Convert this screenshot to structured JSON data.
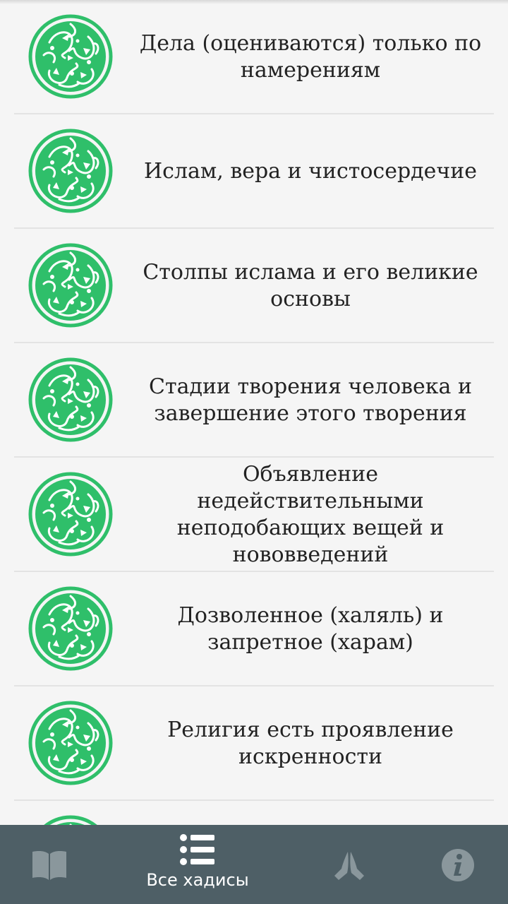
{
  "colors": {
    "accent": "#2fbf6a",
    "nav_background": "#4e5f66",
    "nav_inactive": "#8a979c",
    "nav_active": "#ffffff"
  },
  "hadiths": [
    {
      "title": "Дела (оцениваются) только по намерениям",
      "icon": "ornament-icon"
    },
    {
      "title": "Ислам, вера и чистосердечие",
      "icon": "ornament-icon"
    },
    {
      "title": "Столпы ислама и его великие основы",
      "icon": "ornament-icon"
    },
    {
      "title": "Стадии творения человека и завершение этого творения",
      "icon": "ornament-icon"
    },
    {
      "title": "Объявление недействительными неподобающих вещей и нововведений",
      "icon": "ornament-icon"
    },
    {
      "title": "Дозволенное (халяль) и запретное (харам)",
      "icon": "ornament-icon"
    },
    {
      "title": "Религия есть проявление искренности",
      "icon": "ornament-icon"
    }
  ],
  "bottom_nav": {
    "items": [
      {
        "icon": "book-icon",
        "active": false
      },
      {
        "icon": "list-icon",
        "label": "Все хадисы",
        "active": true
      },
      {
        "icon": "praying-hands-icon",
        "active": false
      },
      {
        "icon": "info-icon",
        "active": false
      }
    ]
  }
}
